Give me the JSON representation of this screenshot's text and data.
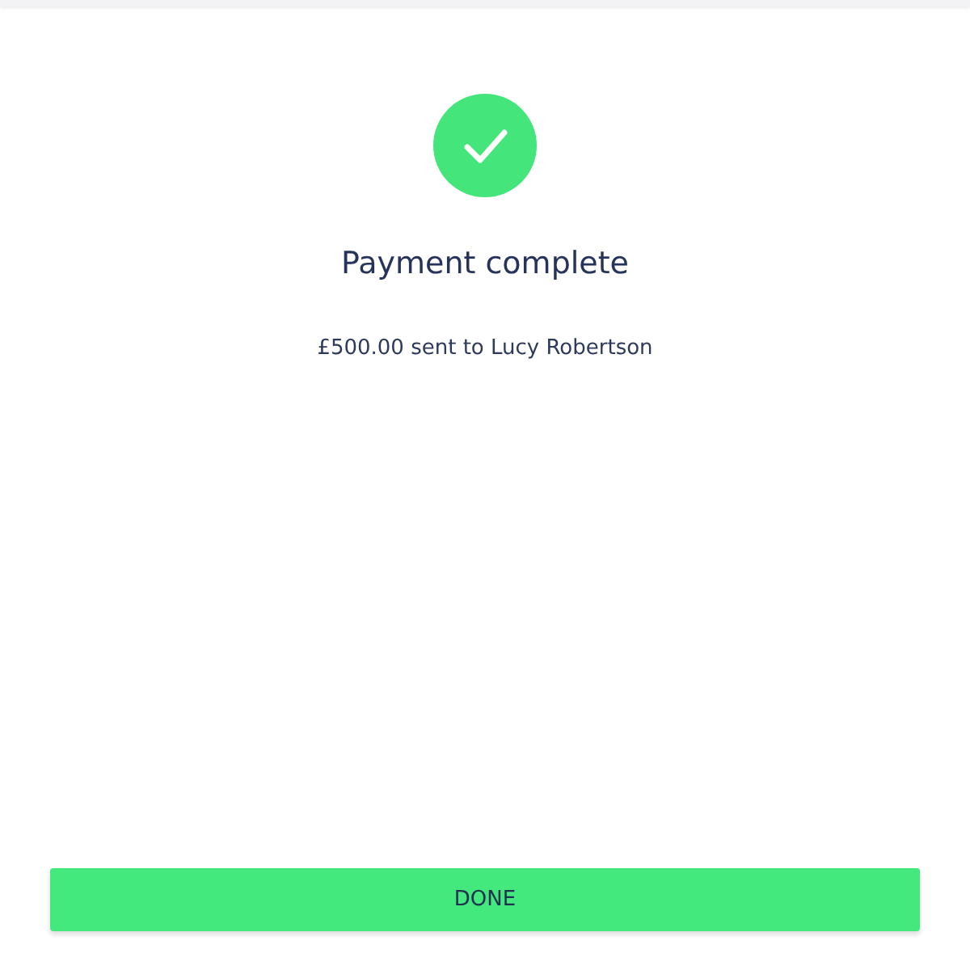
{
  "title": "Payment complete",
  "message": "£500.00 sent to Lucy Robertson",
  "button": "DONE"
}
